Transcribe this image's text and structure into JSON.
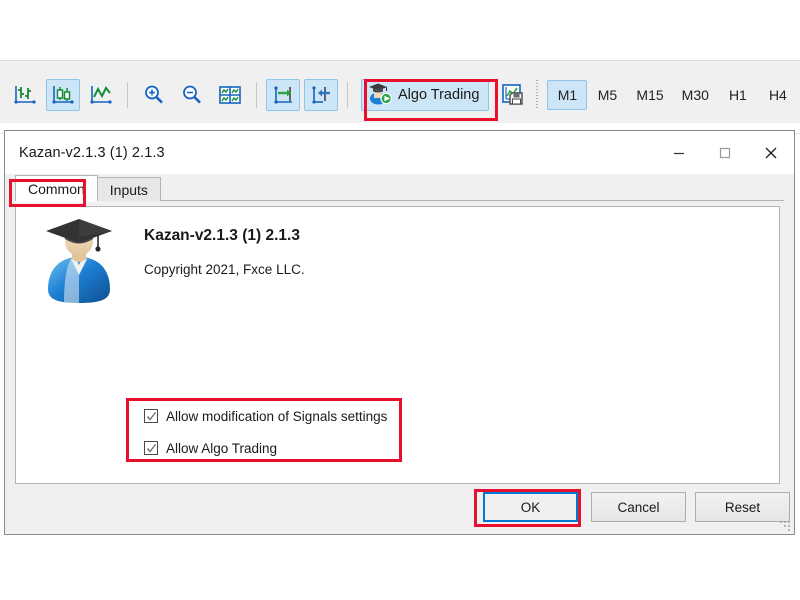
{
  "toolbar": {
    "chart_buttons": [
      {
        "name": "bar-chart-button",
        "label": "Bar Chart",
        "active": false
      },
      {
        "name": "candlestick-chart-button",
        "label": "Candlesticks",
        "active": true
      },
      {
        "name": "line-chart-button",
        "label": "Line Chart",
        "active": false
      }
    ],
    "zoom_buttons": [
      {
        "name": "zoom-in-button",
        "label": "Zoom In"
      },
      {
        "name": "zoom-out-button",
        "label": "Zoom Out"
      },
      {
        "name": "tile-windows-button",
        "label": "Tile Windows"
      }
    ],
    "scroll_buttons": [
      {
        "name": "auto-scroll-button",
        "label": "Auto Scroll",
        "active": true
      },
      {
        "name": "chart-shift-button",
        "label": "Chart Shift",
        "active": true
      }
    ],
    "algo_trading_label": "Algo Trading",
    "template_button_label": "Templates",
    "timeframes": [
      {
        "label": "M1",
        "active": true
      },
      {
        "label": "M5",
        "active": false
      },
      {
        "label": "M15",
        "active": false
      },
      {
        "label": "M30",
        "active": false
      },
      {
        "label": "H1",
        "active": false
      },
      {
        "label": "H4",
        "active": false
      }
    ]
  },
  "dialog": {
    "title": "Kazan-v2.1.3 (1) 2.1.3",
    "window_controls": [
      {
        "name": "minimize-button",
        "glyph": "minimize"
      },
      {
        "name": "maximize-button",
        "glyph": "maximize"
      },
      {
        "name": "close-button",
        "glyph": "close"
      }
    ],
    "tabs": [
      {
        "label": "Common",
        "selected": true
      },
      {
        "label": "Inputs",
        "selected": false
      }
    ],
    "product": {
      "title": "Kazan-v2.1.3 (1) 2.1.3",
      "copyright": "Copyright 2021, Fxce LLC.",
      "icon": "expert-advisor-graduate-icon"
    },
    "checkboxes": [
      {
        "label": "Allow modification of Signals settings",
        "checked": true
      },
      {
        "label": "Allow Algo Trading",
        "checked": true
      }
    ],
    "buttons": [
      {
        "label": "OK",
        "primary": true
      },
      {
        "label": "Cancel",
        "primary": false
      },
      {
        "label": "Reset",
        "primary": false
      }
    ]
  },
  "annotations": {
    "color": "#e8112d",
    "boxes": [
      {
        "name": "annotation-algo-trading",
        "target": "Algo Trading toolbar button"
      },
      {
        "name": "annotation-common-tab",
        "target": "Common tab"
      },
      {
        "name": "annotation-checkboxes",
        "target": "Allow checkboxes group"
      },
      {
        "name": "annotation-ok-button",
        "target": "OK button"
      }
    ]
  }
}
